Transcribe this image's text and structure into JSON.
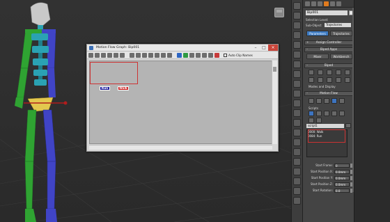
{
  "dialog": {
    "title": "Motion Flow Graph: Bip001",
    "auto_clip_names_label": "Auto Clip Names",
    "nodes": [
      {
        "label": "Run",
        "color": "#1d1d9c"
      },
      {
        "label": "Walk",
        "color": "#c61414"
      }
    ]
  },
  "panel": {
    "object_name": "Bip001",
    "selection_level_label": "Selection Level:",
    "sub_object_label": "Sub-Object",
    "sub_object_value": "Trajectories",
    "parameters_button": "Parameters",
    "trajectories_button": "Trajectories",
    "assign_controller_title": "Assign Controller",
    "biped_apps_title": "Biped Apps",
    "mixer_button": "Mixer",
    "workbench_button": "Workbench",
    "biped_title": "Biped",
    "modes_display_title": "Modes and Display",
    "motion_flow_title": "Motion Flow",
    "scripts_label": "Scripts",
    "script_name": "script1",
    "script_rows": [
      "0000: Walk",
      "0084: Run"
    ],
    "fields": [
      {
        "label": "Start Frame:",
        "value": "0"
      },
      {
        "label": "Start Position X:",
        "value": "0.0mm"
      },
      {
        "label": "Start Position Y:",
        "value": "0.0mm"
      },
      {
        "label": "Start Position Z:",
        "value": "0.0mm"
      },
      {
        "label": "Start Rotation:",
        "value": "0.0"
      }
    ]
  },
  "colors": {
    "accent_orange": "#e07b1e",
    "selection_blue": "#3c7bc4",
    "highlight_red": "#cc3333",
    "left_limbs_green": "#2fa332",
    "right_limbs_blue": "#4044c6",
    "spine_cyan": "#2aa2b3"
  }
}
